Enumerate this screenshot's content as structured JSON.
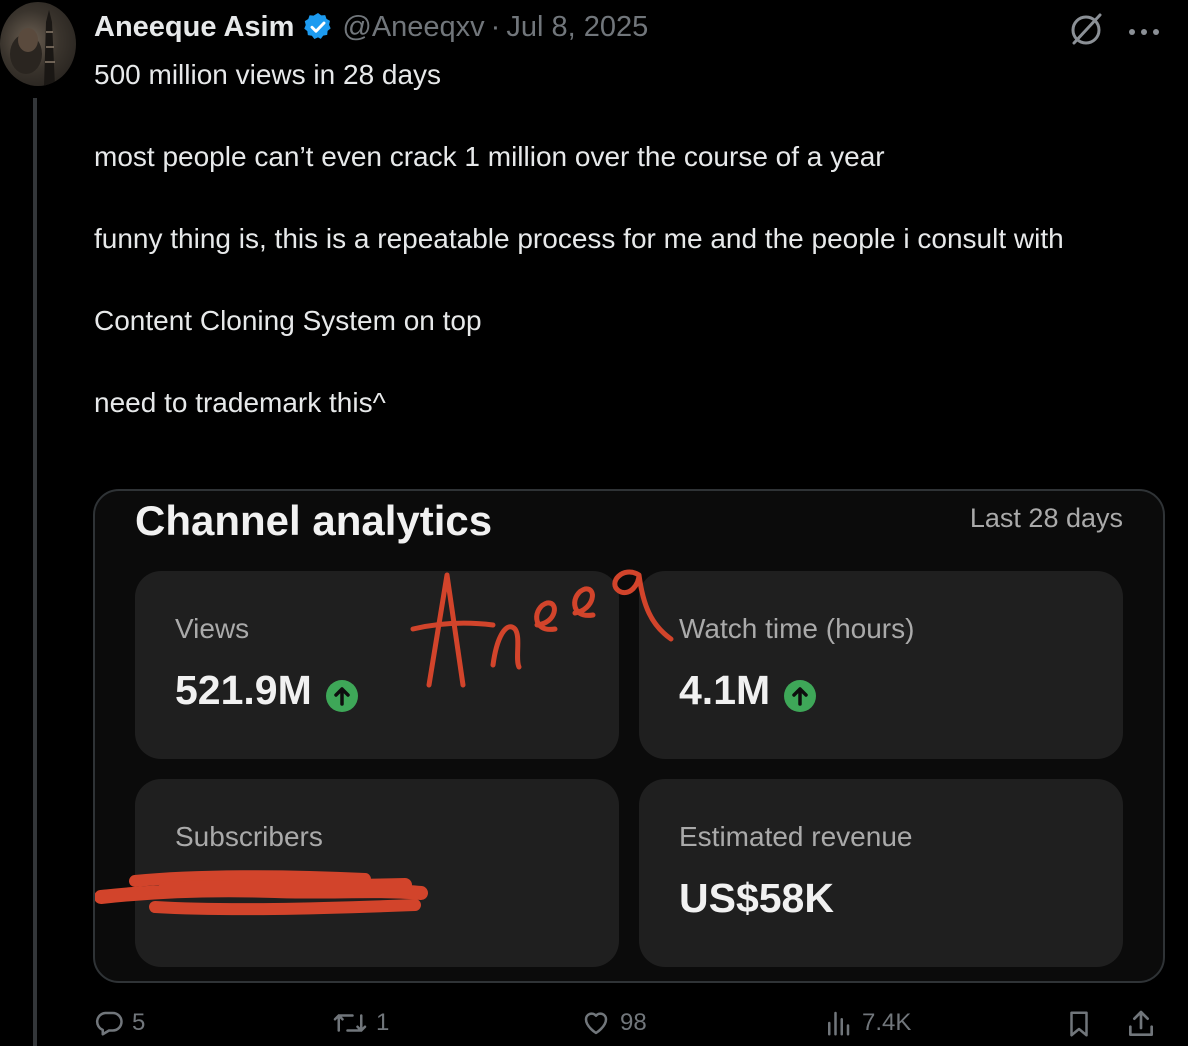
{
  "tweet": {
    "author_name": "Aneeque Asim",
    "handle": "@Aneeqxv",
    "separator": "·",
    "date": "Jul 8, 2025",
    "verified_color": "#1d9bf0",
    "paragraphs": [
      "500 million views in 28 days",
      "most people can’t even crack 1 million over the course of a year",
      "funny thing is, this is a repeatable process for me and the people i consult with",
      "Content Cloning System on top",
      "need to trademark this^"
    ]
  },
  "media": {
    "title": "Channel analytics",
    "period": "Last 28 days",
    "signature_text": "Aneeq",
    "cards": [
      {
        "label": "Views",
        "value": "521.9M",
        "trend": "up"
      },
      {
        "label": "Watch time (hours)",
        "value": "4.1M",
        "trend": "up"
      },
      {
        "label": "Subscribers",
        "value": "",
        "redacted": true
      },
      {
        "label": "Estimated revenue",
        "value": "US$58K"
      }
    ],
    "trend_color": "#3ea758",
    "redaction_color": "#d2442b"
  },
  "actions": {
    "reply_count": "5",
    "retweet_count": "1",
    "like_count": "98",
    "view_count": "7.4K"
  },
  "icons": {
    "header": [
      "grok-icon",
      "more-icon"
    ],
    "actions": [
      "reply-icon",
      "retweet-icon",
      "like-icon",
      "views-icon",
      "bookmark-icon",
      "share-icon"
    ]
  }
}
